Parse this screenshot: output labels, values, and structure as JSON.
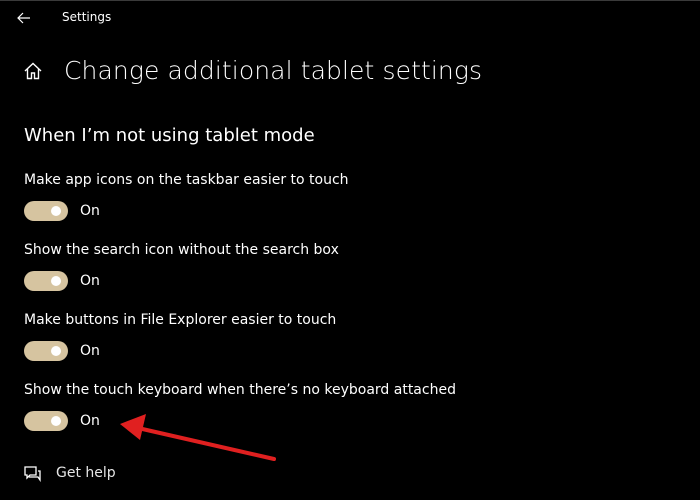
{
  "window": {
    "title": "Settings",
    "back_icon": "back-arrow-icon"
  },
  "header": {
    "home_icon": "home-icon",
    "title": "Change additional tablet settings"
  },
  "section": {
    "title": "When I’m not using tablet mode"
  },
  "settings": [
    {
      "label": "Make app icons on the taskbar easier to touch",
      "state": "On",
      "on": true
    },
    {
      "label": "Show the search icon without the search box",
      "state": "On",
      "on": true
    },
    {
      "label": "Make buttons in File Explorer easier to touch",
      "state": "On",
      "on": true
    },
    {
      "label": "Show the touch keyboard when there’s no keyboard attached",
      "state": "On",
      "on": true
    }
  ],
  "help": {
    "label": "Get help",
    "icon": "chat-help-icon"
  },
  "annotation": {
    "arrow_color": "#e02020"
  },
  "colors": {
    "background": "#000000",
    "toggle_on": "#d6c4a0",
    "text": "#ffffff"
  }
}
